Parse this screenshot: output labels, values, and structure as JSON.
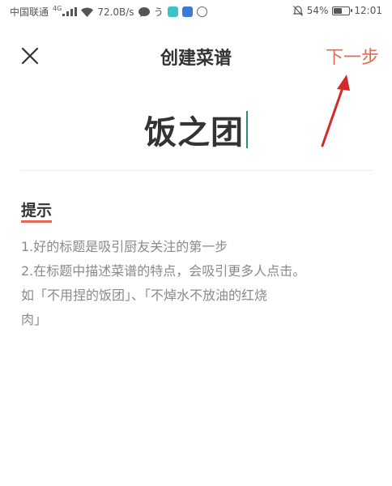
{
  "status_bar": {
    "carrier": "中国联通",
    "network_type": "4G",
    "speed": "72.0B/s",
    "battery": "54%",
    "battery_level": 0.54,
    "time": "12:01",
    "icons": [
      "signal-icon",
      "wifi-icon",
      "chat-bubble-icon",
      "app-icon",
      "app-icon-cyan",
      "app-icon-blue",
      "app-icon-gray",
      "mute-icon",
      "battery-icon"
    ]
  },
  "header": {
    "title": "创建菜谱",
    "next_label": "下一步",
    "close_icon": "close-icon"
  },
  "title_input": {
    "value": "饭之团"
  },
  "tips": {
    "heading": "提示",
    "lines": [
      "1.好的标题是吸引厨友关注的第一步",
      "2.在标题中描述菜谱的特点，会吸引更多人点击。",
      "如「不用捏的饭团」、「不焯水不放油的红烧",
      "肉」"
    ]
  },
  "colors": {
    "accent": "#e06a53",
    "caret": "#2a8c7a",
    "annotation_arrow": "#d42a2a",
    "text_primary": "#333333",
    "text_muted": "#8a8a8a"
  }
}
